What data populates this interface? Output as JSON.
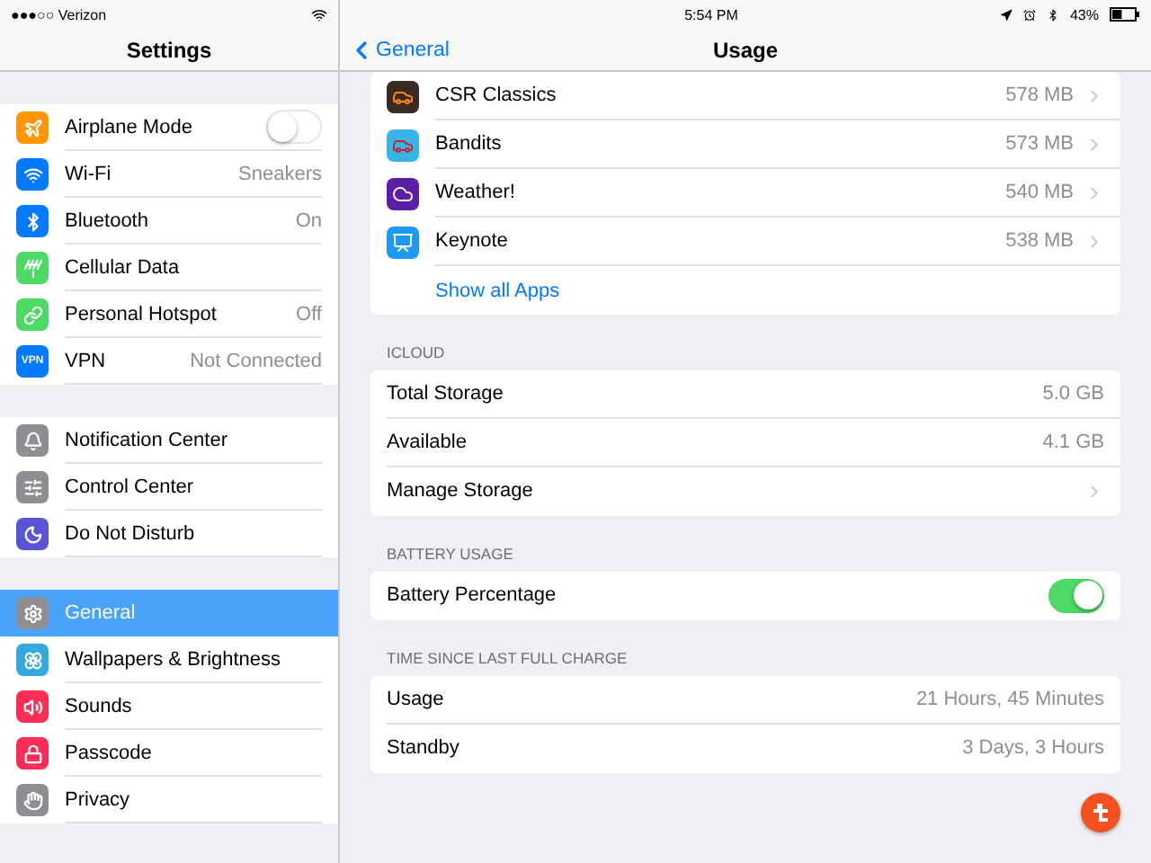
{
  "status_bar": {
    "carrier": "●●●○○ Verizon",
    "time": "5:54 PM",
    "battery": "43%"
  },
  "sidebar": {
    "title": "Settings",
    "groups": [
      [
        {
          "label": "Airplane Mode",
          "color": "#ff9500",
          "kind": "toggle",
          "on": false,
          "selected": false
        },
        {
          "label": "Wi-Fi",
          "color": "#007aff",
          "kind": "value",
          "value": "Sneakers",
          "selected": false
        },
        {
          "label": "Bluetooth",
          "color": "#007aff",
          "kind": "value",
          "value": "On",
          "selected": false
        },
        {
          "label": "Cellular Data",
          "color": "#4cd964",
          "kind": "plain",
          "selected": false
        },
        {
          "label": "Personal Hotspot",
          "color": "#4cd964",
          "kind": "value",
          "value": "Off",
          "selected": false
        },
        {
          "label": "VPN",
          "icon_text": "VPN",
          "color": "#007aff",
          "kind": "value",
          "value": "Not Connected",
          "selected": false
        }
      ],
      [
        {
          "label": "Notification Center",
          "color": "#8e8e93",
          "kind": "plain",
          "selected": false
        },
        {
          "label": "Control Center",
          "color": "#8e8e93",
          "kind": "plain",
          "selected": false
        },
        {
          "label": "Do Not Disturb",
          "color": "#5856d6",
          "kind": "plain",
          "selected": false
        }
      ],
      [
        {
          "label": "General",
          "color": "#8e8e93",
          "kind": "plain",
          "selected": true
        },
        {
          "label": "Wallpapers & Brightness",
          "color": "#34aadc",
          "kind": "plain",
          "selected": false
        },
        {
          "label": "Sounds",
          "color": "#ff2d55",
          "kind": "plain",
          "selected": false
        },
        {
          "label": "Passcode",
          "color": "#ff2d55",
          "kind": "plain",
          "selected": false
        },
        {
          "label": "Privacy",
          "color": "#8e8e93",
          "kind": "plain",
          "selected": false
        }
      ]
    ]
  },
  "nav": {
    "back": "General",
    "title": "Usage"
  },
  "apps": [
    {
      "name": "CSR Classics",
      "size": "578 MB"
    },
    {
      "name": "Bandits",
      "size": "573 MB"
    },
    {
      "name": "Weather!",
      "size": "540 MB"
    },
    {
      "name": "Keynote",
      "size": "538 MB"
    }
  ],
  "show_all": "Show all Apps",
  "sections": [
    {
      "header": "ICLOUD",
      "rows": [
        {
          "label": "Total Storage",
          "kind": "value",
          "value": "5.0 GB"
        },
        {
          "label": "Available",
          "kind": "value",
          "value": "4.1 GB"
        },
        {
          "label": "Manage Storage",
          "kind": "chevron"
        }
      ]
    },
    {
      "header": "BATTERY USAGE",
      "rows": [
        {
          "label": "Battery Percentage",
          "kind": "toggle",
          "on": true
        }
      ]
    },
    {
      "header": "TIME SINCE LAST FULL CHARGE",
      "rows": [
        {
          "label": "Usage",
          "kind": "value",
          "value": "21 Hours, 45 Minutes"
        },
        {
          "label": "Standby",
          "kind": "value",
          "value": "3 Days, 3 Hours"
        }
      ]
    }
  ]
}
